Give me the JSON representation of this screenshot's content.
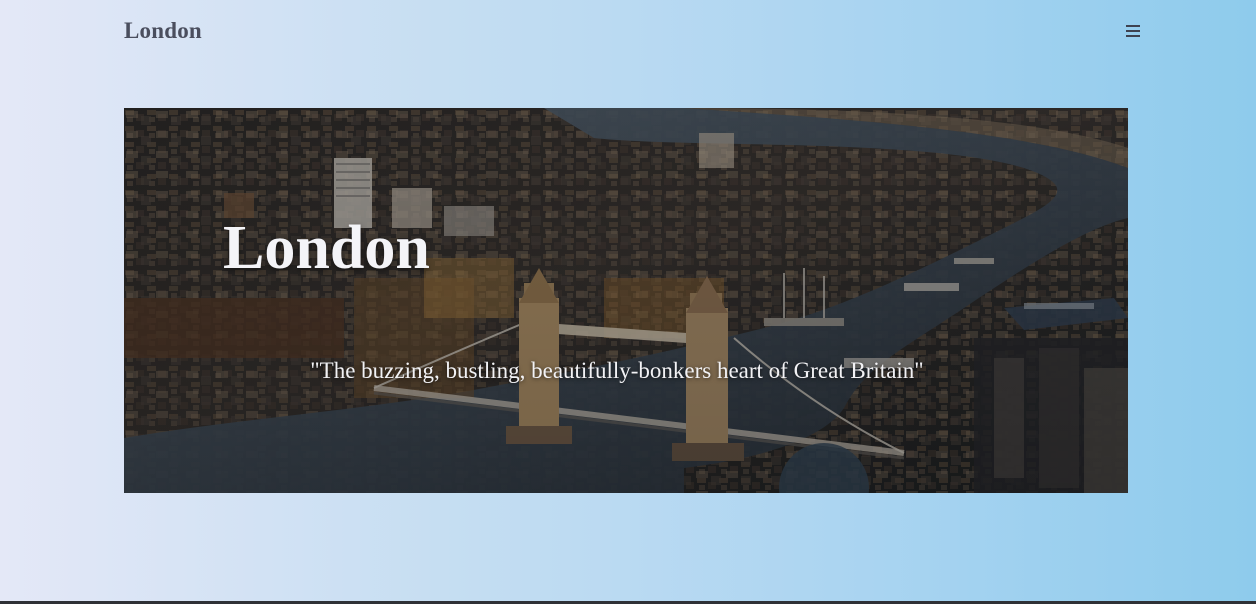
{
  "header": {
    "brand": "London",
    "menu_icon": "hamburger-menu-icon"
  },
  "hero": {
    "title": "London",
    "tagline": "\"The buzzing, bustling, beautifully-bonkers heart of Great Britain\"",
    "image_subject": "aerial-city-river-bridge-photo"
  },
  "colors": {
    "background_start": "#e4e8f7",
    "background_end": "#8ecbec",
    "brand_text": "#4a4e5e",
    "hero_text": "#f4f4f8",
    "bottom_bar": "#2f3136"
  }
}
